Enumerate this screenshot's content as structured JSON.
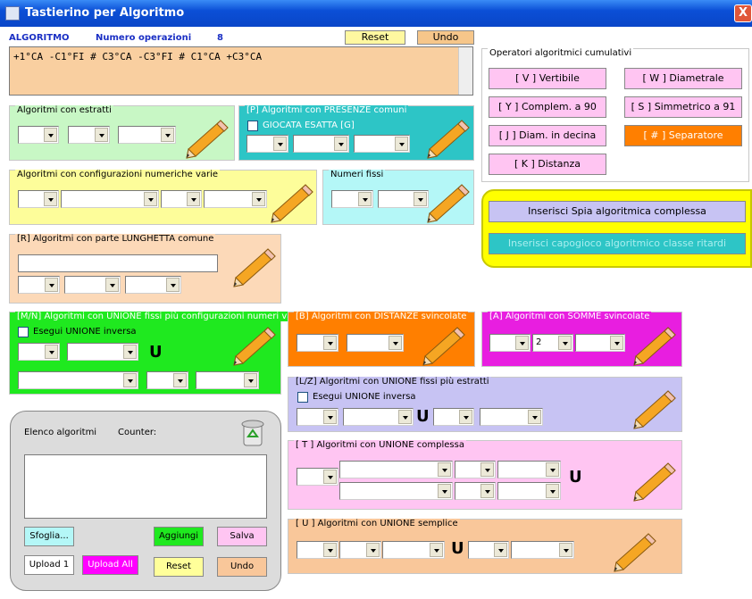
{
  "window": {
    "title": "Tastierino per Algoritmo",
    "close": "X"
  },
  "header": {
    "algoritmo_label": "ALGORITMO",
    "num_ops_label": "Numero operazioni",
    "num_ops_value": "8",
    "reset": "Reset",
    "undo": "Undo"
  },
  "expression": "+1°CA -C1°FI # C3°CA -C3°FI # C1°CA +C3°CA",
  "groups": {
    "estratti": "Algoritmi con estratti",
    "presenze": "[P] Algoritmi con PRESENZE comuni",
    "giocata": "GIOCATA ESATTA  [G]",
    "configurazioni": "Algoritmi con configurazioni numeriche varie",
    "fissi": "Numeri fissi",
    "lunghetta": "[R] Algoritmi con parte LUNGHETTA comune",
    "mn": "[M/N] Algoritmi con UNIONE fissi più configurazioni numeri vari",
    "mn_check": "Esegui UNIONE inversa",
    "distanze": "[B] Algoritmi con DISTANZE svincolate",
    "somme": "[A] Algoritmi con SOMME svincolate",
    "somme_value": "2",
    "lz": "[L/Z] Algoritmi con UNIONE fissi più estratti",
    "lz_check": "Esegui UNIONE inversa",
    "t": "[ T ] Algoritmi con UNIONE complessa",
    "u": "[ U ] Algoritmi con UNIONE semplice",
    "operatori": "Operatori algoritmici cumulativi"
  },
  "u_symbol": "U",
  "operators": [
    "[ V ] Vertibile",
    "[ W ] Diametrale",
    "[ Y ] Complem. a 90",
    "[ S ] Simmetrico  a 91",
    "[ J ] Diam. in decina",
    "[ # ] Separatore",
    "[ K ] Distanza"
  ],
  "spia": {
    "insert": "Inserisci Spia algoritmica complessa",
    "capogioco": "Inserisci capogioco algoritmico classe ritardi"
  },
  "elenco": {
    "label": "Elenco algoritmi",
    "counter": "Counter:",
    "sfoglia": "Sfoglia...",
    "aggiungi": "Aggiungi",
    "salva": "Salva",
    "upload1": "Upload 1",
    "uploadall": "Upload All",
    "reset": "Reset",
    "undo": "Undo"
  }
}
